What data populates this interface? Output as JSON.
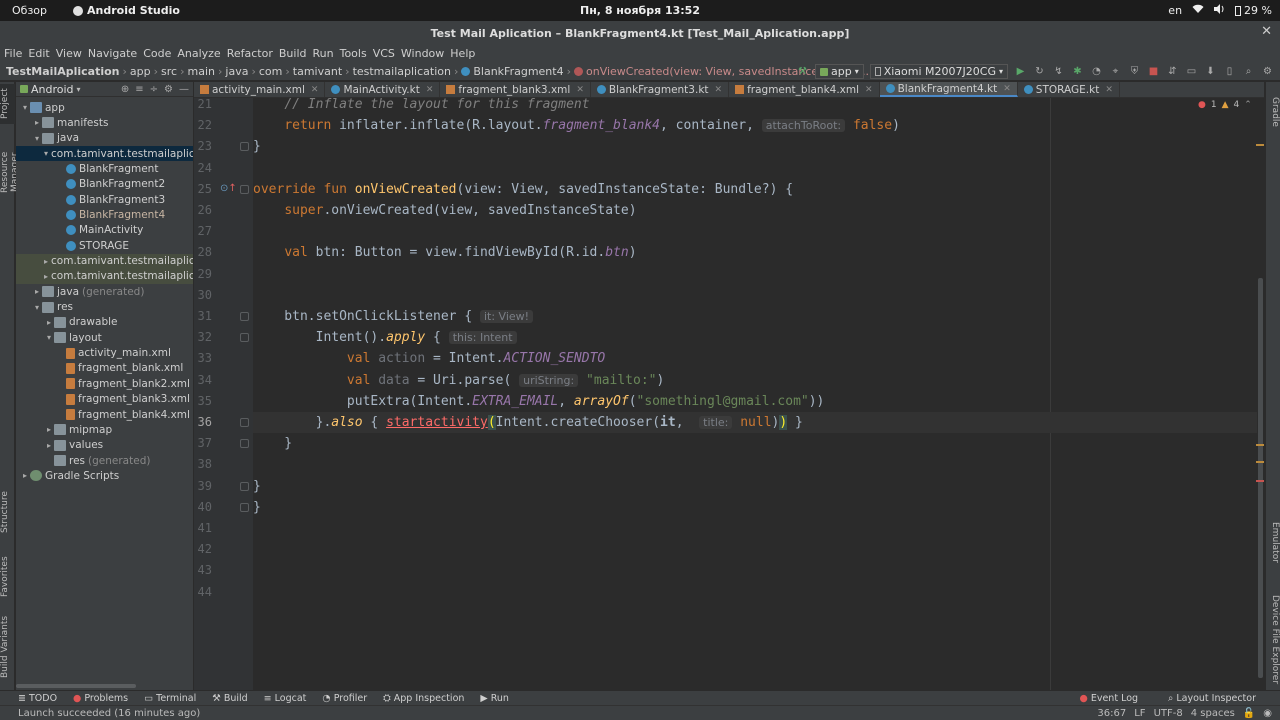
{
  "gnome": {
    "overview": "Обзор",
    "app_name": "Android Studio",
    "clock": "Пн, 8 ноября  13:52",
    "lang": "en",
    "battery": "29 %"
  },
  "window": {
    "title": "Test Mail Aplication – BlankFragment4.kt [Test_Mail_Aplication.app]"
  },
  "menu": [
    "File",
    "Edit",
    "View",
    "Navigate",
    "Code",
    "Analyze",
    "Refactor",
    "Build",
    "Run",
    "Tools",
    "VCS",
    "Window",
    "Help"
  ],
  "breadcrumb": [
    "TestMailAplication",
    "app",
    "src",
    "main",
    "java",
    "com",
    "tamivant",
    "testmailaplication",
    "BlankFragment4",
    "onViewCreated(view: View, savedInstanceState: B..."
  ],
  "run_config": {
    "module": "app",
    "device": "Xiaomi M2007J20CG"
  },
  "project_panel": {
    "view_mode": "Android",
    "tree": [
      {
        "label": "app",
        "depth": 0,
        "arrow": "▾",
        "icon": "folder-blue"
      },
      {
        "label": "manifests",
        "depth": 1,
        "arrow": "▸",
        "icon": "folder"
      },
      {
        "label": "java",
        "depth": 1,
        "arrow": "▾",
        "icon": "folder"
      },
      {
        "label": "com.tamivant.testmailaplica",
        "depth": 2,
        "arrow": "▾",
        "icon": "folder",
        "selected": true
      },
      {
        "label": "BlankFragment",
        "depth": 3,
        "arrow": "",
        "icon": "kt"
      },
      {
        "label": "BlankFragment2",
        "depth": 3,
        "arrow": "",
        "icon": "kt"
      },
      {
        "label": "BlankFragment3",
        "depth": 3,
        "arrow": "",
        "icon": "kt"
      },
      {
        "label": "BlankFragment4",
        "depth": 3,
        "arrow": "",
        "icon": "kt",
        "accent": true
      },
      {
        "label": "MainActivity",
        "depth": 3,
        "arrow": "",
        "icon": "kt"
      },
      {
        "label": "STORAGE",
        "depth": 3,
        "arrow": "",
        "icon": "kt"
      },
      {
        "label": "com.tamivant.testmailaplica",
        "depth": 2,
        "arrow": "▸",
        "icon": "folder",
        "highlight": true
      },
      {
        "label": "com.tamivant.testmailaplica",
        "depth": 2,
        "arrow": "▸",
        "icon": "folder",
        "highlight": true
      },
      {
        "label": "java",
        "depth": 1,
        "arrow": "▸",
        "icon": "folder",
        "suffix": "(generated)"
      },
      {
        "label": "res",
        "depth": 1,
        "arrow": "▾",
        "icon": "folder"
      },
      {
        "label": "drawable",
        "depth": 2,
        "arrow": "▸",
        "icon": "folder"
      },
      {
        "label": "layout",
        "depth": 2,
        "arrow": "▾",
        "icon": "folder"
      },
      {
        "label": "activity_main.xml",
        "depth": 3,
        "arrow": "",
        "icon": "xml"
      },
      {
        "label": "fragment_blank.xml",
        "depth": 3,
        "arrow": "",
        "icon": "xml"
      },
      {
        "label": "fragment_blank2.xml",
        "depth": 3,
        "arrow": "",
        "icon": "xml"
      },
      {
        "label": "fragment_blank3.xml",
        "depth": 3,
        "arrow": "",
        "icon": "xml"
      },
      {
        "label": "fragment_blank4.xml",
        "depth": 3,
        "arrow": "",
        "icon": "xml"
      },
      {
        "label": "mipmap",
        "depth": 2,
        "arrow": "▸",
        "icon": "folder"
      },
      {
        "label": "values",
        "depth": 2,
        "arrow": "▸",
        "icon": "folder"
      },
      {
        "label": "res",
        "depth": 2,
        "arrow": "",
        "icon": "folder",
        "suffix": "(generated)"
      },
      {
        "label": "Gradle Scripts",
        "depth": 0,
        "arrow": "▸",
        "icon": "gradle"
      }
    ]
  },
  "tabs": [
    {
      "label": "activity_main.xml",
      "icon": "xml"
    },
    {
      "label": "MainActivity.kt",
      "icon": "kt"
    },
    {
      "label": "fragment_blank3.xml",
      "icon": "xml"
    },
    {
      "label": "BlankFragment3.kt",
      "icon": "kt"
    },
    {
      "label": "fragment_blank4.xml",
      "icon": "xml"
    },
    {
      "label": "BlankFragment4.kt",
      "icon": "kt",
      "active": true
    },
    {
      "label": "STORAGE.kt",
      "icon": "kt"
    }
  ],
  "inspection": {
    "errors": "1",
    "warnings": "4"
  },
  "editor": {
    "current_line": 36,
    "lines": [
      {
        "n": "21",
        "html": "    <span class=\"cm\">// Inflate the layout for this fragment</span>"
      },
      {
        "n": "22",
        "html": "    <span class=\"kw\">return</span> inflater.inflate(R.layout.<span class=\"it\">fragment_blank4</span>, container, <span class=\"hint\">attachToRoot:</span> <span class=\"kw\">false</span>)"
      },
      {
        "n": "23",
        "html": "}"
      },
      {
        "n": "24",
        "html": ""
      },
      {
        "n": "25",
        "html": "<span class=\"kw\">override fun</span> <span class=\"fn\">onViewCreated</span>(view: View, savedInstanceState: Bundle?) {"
      },
      {
        "n": "26",
        "html": "    <span class=\"kw\">super</span>.onViewCreated(view, savedInstanceState)"
      },
      {
        "n": "27",
        "html": ""
      },
      {
        "n": "28",
        "html": "    <span class=\"kw\">val</span> btn: Button = view.findViewById(R.id.<span class=\"it\">btn</span>)"
      },
      {
        "n": "29",
        "html": ""
      },
      {
        "n": "30",
        "html": ""
      },
      {
        "n": "31",
        "html": "    btn.setOnClickListener { <span class=\"hint\">it: View!</span>"
      },
      {
        "n": "32",
        "html": "        Intent().<span class=\"ext\">apply</span> { <span class=\"hint\">this: Intent</span>"
      },
      {
        "n": "33",
        "html": "            <span class=\"kw\">val</span> <span class=\"loc\">action</span> = Intent.<span class=\"it\">ACTION_SENDTO</span>"
      },
      {
        "n": "34",
        "html": "            <span class=\"kw\">val</span> <span class=\"loc\">data</span> = Uri.parse( <span class=\"hint\">uriString:</span> <span class=\"st\">\"mailto:\"</span>)"
      },
      {
        "n": "35",
        "html": "            putExtra(Intent.<span class=\"it\">EXTRA_EMAIL</span>, <span class=\"ext\">arrayOf</span>(<span class=\"st\">\"somethingl@gmail.com\"</span>))"
      },
      {
        "n": "36",
        "html": "        }.<span class=\"ext\">also</span> { <span class=\"err\">startactivity</span><span class=\"brace-hl\">(</span>Intent.createChooser(<span class=\"lam\">it</span>,  <span class=\"hint\">title:</span> <span class=\"kw\">null</span>)<span class=\"brace-hl\">)</span> }"
      },
      {
        "n": "37",
        "html": "    }"
      },
      {
        "n": "38",
        "html": ""
      },
      {
        "n": "39",
        "html": "}"
      },
      {
        "n": "40",
        "html": "}"
      },
      {
        "n": "41",
        "html": ""
      },
      {
        "n": "42",
        "html": ""
      },
      {
        "n": "43",
        "html": ""
      },
      {
        "n": "44",
        "html": ""
      }
    ]
  },
  "side_tabs": {
    "left": [
      "Project",
      "Resource Manager",
      "Structure",
      "Favorites",
      "Build Variants"
    ],
    "right": [
      "Gradle",
      "Emulator",
      "Device File Explorer"
    ]
  },
  "tool_windows": [
    "TODO",
    "Problems",
    "Terminal",
    "Build",
    "Logcat",
    "Profiler",
    "App Inspection",
    "Run"
  ],
  "tool_windows_right": [
    "Event Log",
    "Layout Inspector"
  ],
  "status": {
    "message": "Launch succeeded (16 minutes ago)",
    "position": "36:67",
    "line_sep": "LF",
    "encoding": "UTF-8",
    "indent": "4 spaces"
  }
}
